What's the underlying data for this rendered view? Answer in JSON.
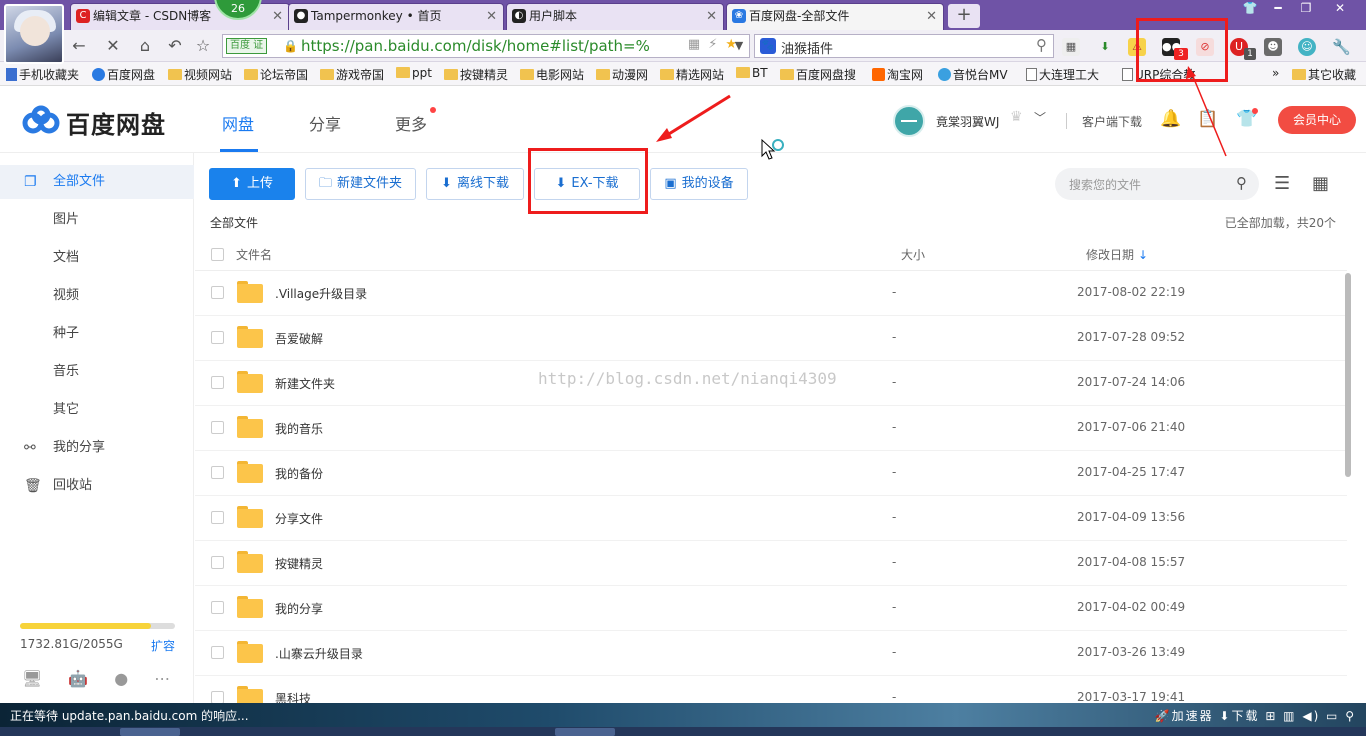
{
  "browser": {
    "tabs": [
      {
        "label": "编辑文章 - CSDN博客",
        "icon_color": "#d22"
      },
      {
        "label": "Tampermonkey • 首页",
        "icon_color": "#222"
      },
      {
        "label": "用户脚本",
        "icon_color": "#222"
      },
      {
        "label": "百度网盘-全部文件",
        "icon_color": "#2a7ae2"
      }
    ],
    "badge": "26",
    "new_tab": "+",
    "url_tag": "百度 证",
    "url": "https://pan.baidu.com/disk/home#list/path=%",
    "search_engine": "油猴插件",
    "ext_badges": [
      "3",
      "1"
    ],
    "bookmarks": [
      "手机收藏夹",
      "百度网盘",
      "视频网站",
      "论坛帝国",
      "游戏帝国",
      "ppt",
      "按键精灵",
      "电影网站",
      "动漫网",
      "精选网站",
      "BT",
      "百度网盘搜",
      "淘宝网",
      "音悦台MV",
      "大连理工大",
      "URP综合教",
      "»",
      "其它收藏"
    ]
  },
  "header": {
    "logo": "百度网盘",
    "nav": [
      "网盘",
      "分享",
      "更多"
    ],
    "username": "竟棠羽翼WJ",
    "client_download": "客户端下载",
    "vip": "会员中心",
    "brand_color": "#1a7af0"
  },
  "sidebar": {
    "items": [
      {
        "label": "全部文件",
        "icon": "files-icon"
      },
      {
        "label": "图片",
        "icon": ""
      },
      {
        "label": "文档",
        "icon": ""
      },
      {
        "label": "视频",
        "icon": ""
      },
      {
        "label": "种子",
        "icon": ""
      },
      {
        "label": "音乐",
        "icon": ""
      },
      {
        "label": "其它",
        "icon": ""
      },
      {
        "label": "我的分享",
        "icon": "share-icon"
      },
      {
        "label": "回收站",
        "icon": "trash-icon"
      }
    ],
    "quota": "1732.81G/2055G",
    "quota_used": 0.843,
    "expand": "扩容"
  },
  "toolbar": {
    "upload": "上传",
    "new_folder": "新建文件夹",
    "offline_download": "离线下载",
    "ex_download": "EX-下载",
    "my_devices": "我的设备",
    "search_placeholder": "搜索您的文件"
  },
  "list": {
    "breadcrumb": "全部文件",
    "loaded_text": "已全部加载，共20个",
    "columns": {
      "name": "文件名",
      "size": "大小",
      "date": "修改日期"
    },
    "files": [
      {
        "name": ".Village升级目录",
        "size": "-",
        "date": "2017-08-02 22:19"
      },
      {
        "name": "吾爱破解",
        "size": "-",
        "date": "2017-07-28 09:52"
      },
      {
        "name": "新建文件夹",
        "size": "-",
        "date": "2017-07-24 14:06"
      },
      {
        "name": "我的音乐",
        "size": "-",
        "date": "2017-07-06 21:40"
      },
      {
        "name": "我的备份",
        "size": "-",
        "date": "2017-04-25 17:47"
      },
      {
        "name": "分享文件",
        "size": "-",
        "date": "2017-04-09 13:56"
      },
      {
        "name": "按键精灵",
        "size": "-",
        "date": "2017-04-08 15:57"
      },
      {
        "name": "我的分享",
        "size": "-",
        "date": "2017-04-02 00:49"
      },
      {
        "name": ".山寨云升级目录",
        "size": "-",
        "date": "2017-03-26 13:49"
      },
      {
        "name": "黑科技",
        "size": "-",
        "date": "2017-03-17 19:41"
      }
    ]
  },
  "watermark": "http://blog.csdn.net/nianqi4309",
  "status": {
    "left": "正在等待 update.pan.baidu.com 的响应...",
    "accelerator": "加速器",
    "download": "下载"
  }
}
